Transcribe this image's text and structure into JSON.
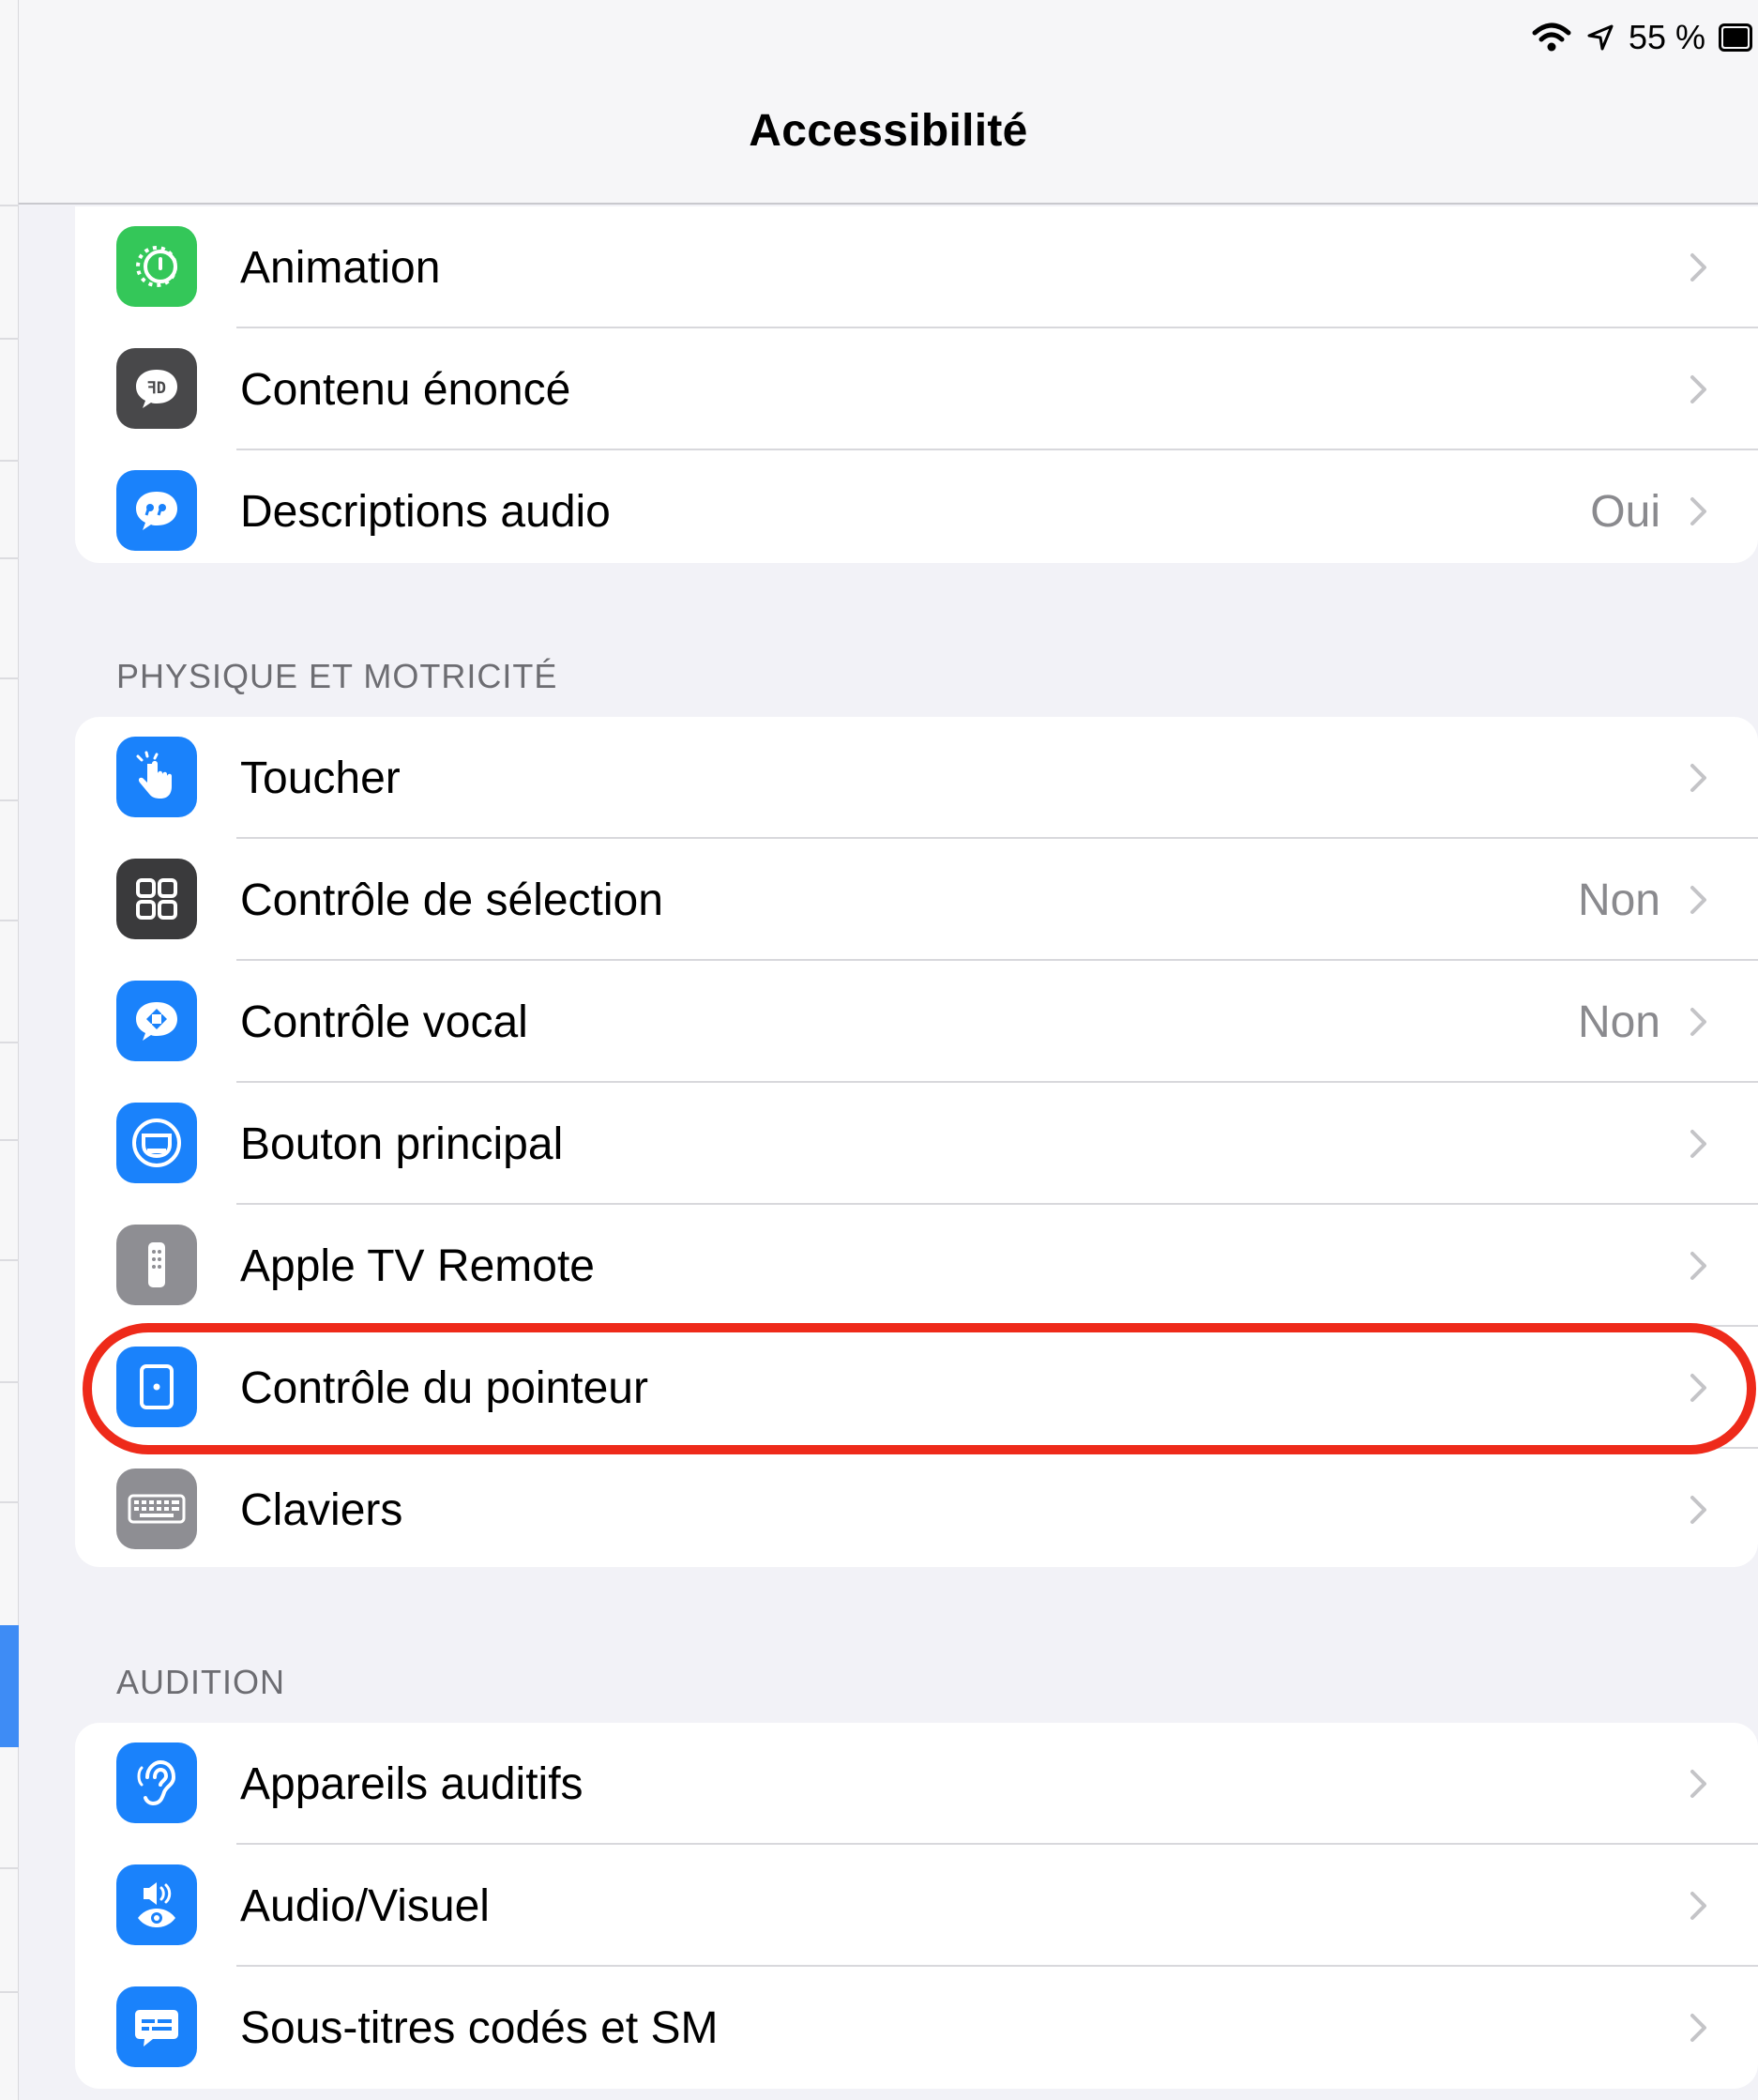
{
  "status_bar": {
    "battery": "55 %"
  },
  "nav": {
    "title": "Accessibilité"
  },
  "group_vision_tail": {
    "items": [
      {
        "label": "Animation",
        "value": "",
        "icon": "motion-icon",
        "color": "#34c759"
      },
      {
        "label": "Contenu énoncé",
        "value": "",
        "icon": "speech-bubble-icon",
        "color": "#48484a"
      },
      {
        "label": "Descriptions audio",
        "value": "Oui",
        "icon": "quote-bubble-icon",
        "color": "#1a82fb"
      }
    ]
  },
  "section_physical": {
    "header": "PHYSIQUE ET MOTRICITÉ",
    "items": [
      {
        "label": "Toucher",
        "value": "",
        "icon": "hand-tap-icon",
        "color": "#1a82fb"
      },
      {
        "label": "Contrôle de sélection",
        "value": "Non",
        "icon": "grid-icon",
        "color": "#3a3a3c"
      },
      {
        "label": "Contrôle vocal",
        "value": "Non",
        "icon": "voice-control-icon",
        "color": "#1a82fb"
      },
      {
        "label": "Bouton principal",
        "value": "",
        "icon": "home-button-icon",
        "color": "#1a82fb"
      },
      {
        "label": "Apple TV Remote",
        "value": "",
        "icon": "remote-icon",
        "color": "#8e8e93"
      },
      {
        "label": "Contrôle du pointeur",
        "value": "",
        "icon": "pointer-icon",
        "color": "#1a82fb"
      },
      {
        "label": "Claviers",
        "value": "",
        "icon": "keyboard-icon",
        "color": "#8e8e93"
      }
    ]
  },
  "section_hearing": {
    "header": "AUDITION",
    "items": [
      {
        "label": "Appareils auditifs",
        "value": "",
        "icon": "ear-icon",
        "color": "#1a82fb"
      },
      {
        "label": "Audio/Visuel",
        "value": "",
        "icon": "audio-visual-icon",
        "color": "#1a82fb"
      },
      {
        "label": "Sous-titres codés et SM",
        "value": "",
        "icon": "captions-icon",
        "color": "#1a82fb"
      }
    ]
  },
  "highlight_color": "#ee2a1a"
}
